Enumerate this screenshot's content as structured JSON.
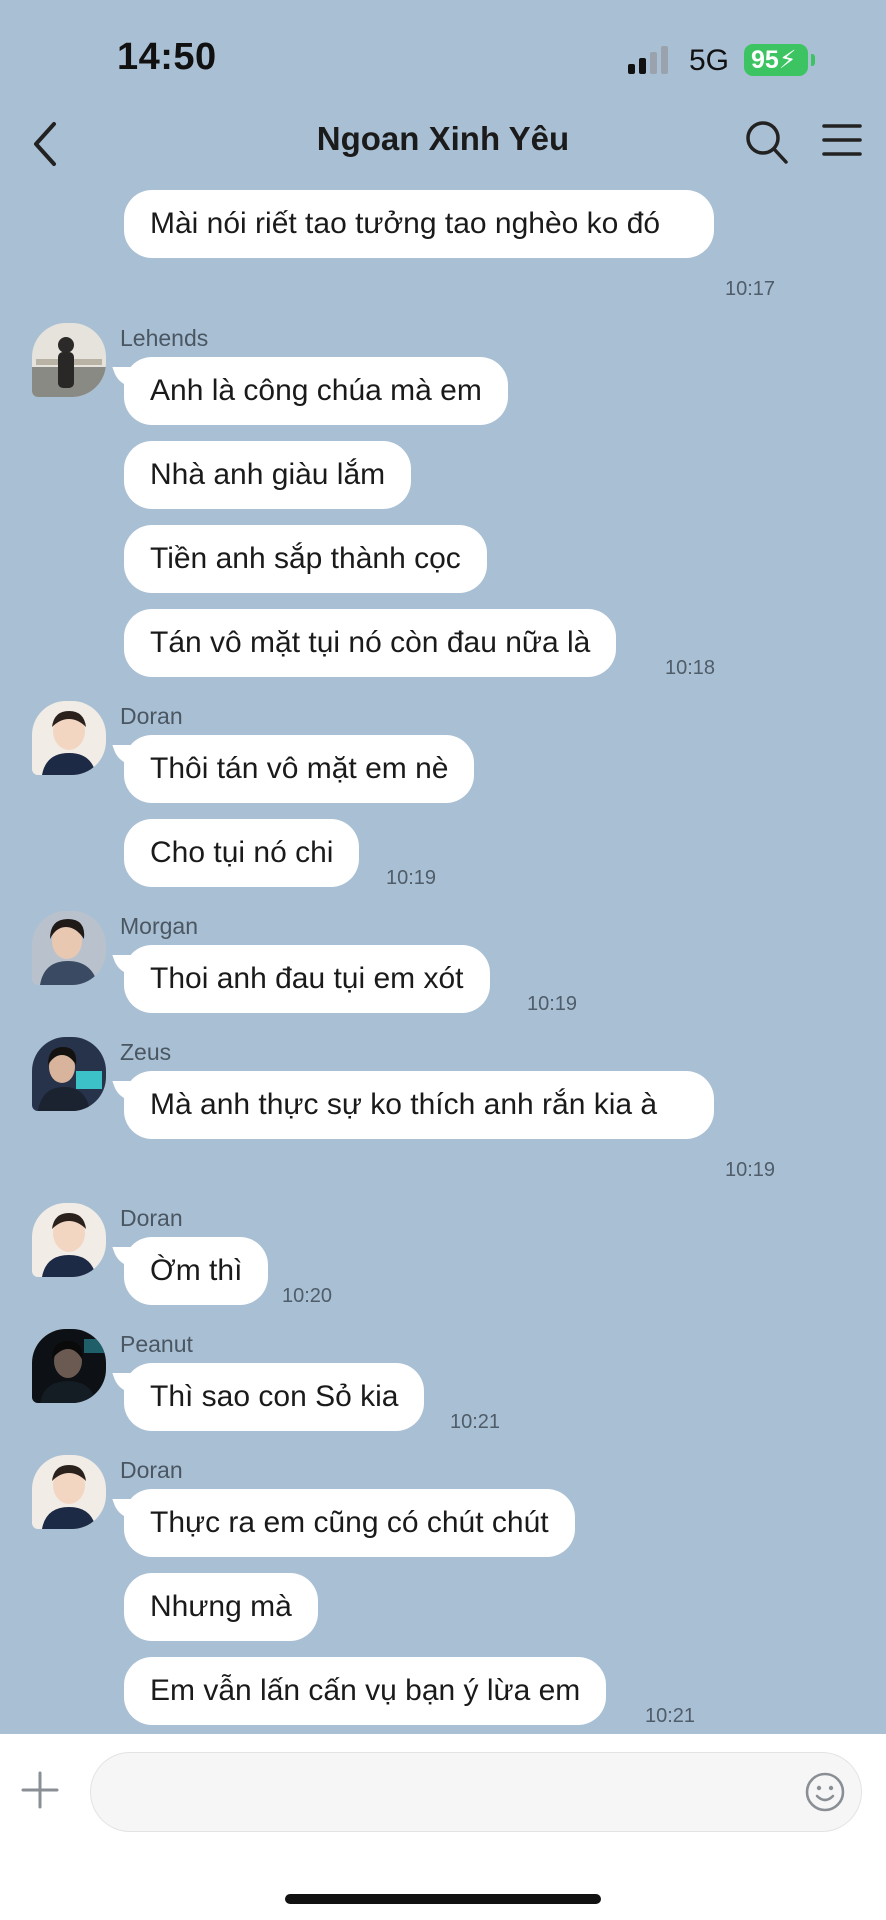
{
  "status": {
    "time": "14:50",
    "network": "5G",
    "battery": "95"
  },
  "header": {
    "title": "Ngoan Xinh Yêu"
  },
  "messages": [
    {
      "text": "Mài nói riết tao tưởng tao nghèo ko đó",
      "time": "10:17"
    },
    {
      "sender": "Lehends",
      "text": "Anh là công chúa mà em"
    },
    {
      "text": "Nhà anh giàu lắm"
    },
    {
      "text": "Tiền anh sắp thành cọc"
    },
    {
      "text": "Tán vô mặt tụi nó còn đau nữa là",
      "time": "10:18"
    },
    {
      "sender": "Doran",
      "text": "Thôi tán vô mặt em nè"
    },
    {
      "text": "Cho tụi nó chi",
      "time": "10:19"
    },
    {
      "sender": "Morgan",
      "text": "Thoi anh đau tụi em xót",
      "time": "10:19"
    },
    {
      "sender": "Zeus",
      "text": "Mà anh thực sự ko thích anh rắn kia à",
      "time": "10:19"
    },
    {
      "sender": "Doran",
      "text": "Ờm thì",
      "time": "10:20"
    },
    {
      "sender": "Peanut",
      "text": "Thì sao con Sỏ kia",
      "time": "10:21"
    },
    {
      "sender": "Doran",
      "text": "Thực ra em cũng có chút chút"
    },
    {
      "text": "Nhưng mà"
    },
    {
      "text": "Em vẫn lấn cấn vụ bạn ý lừa em",
      "time": "10:21"
    }
  ],
  "input": {
    "placeholder": ""
  },
  "icons": {
    "back": "chevron-left-icon",
    "search": "search-icon",
    "menu": "hamburger-menu-icon",
    "plus": "plus-icon",
    "emoji": "smiley-icon"
  },
  "colors": {
    "chat_background": "#a9bfd3",
    "bubble": "#ffffff",
    "battery": "#3cc462"
  }
}
